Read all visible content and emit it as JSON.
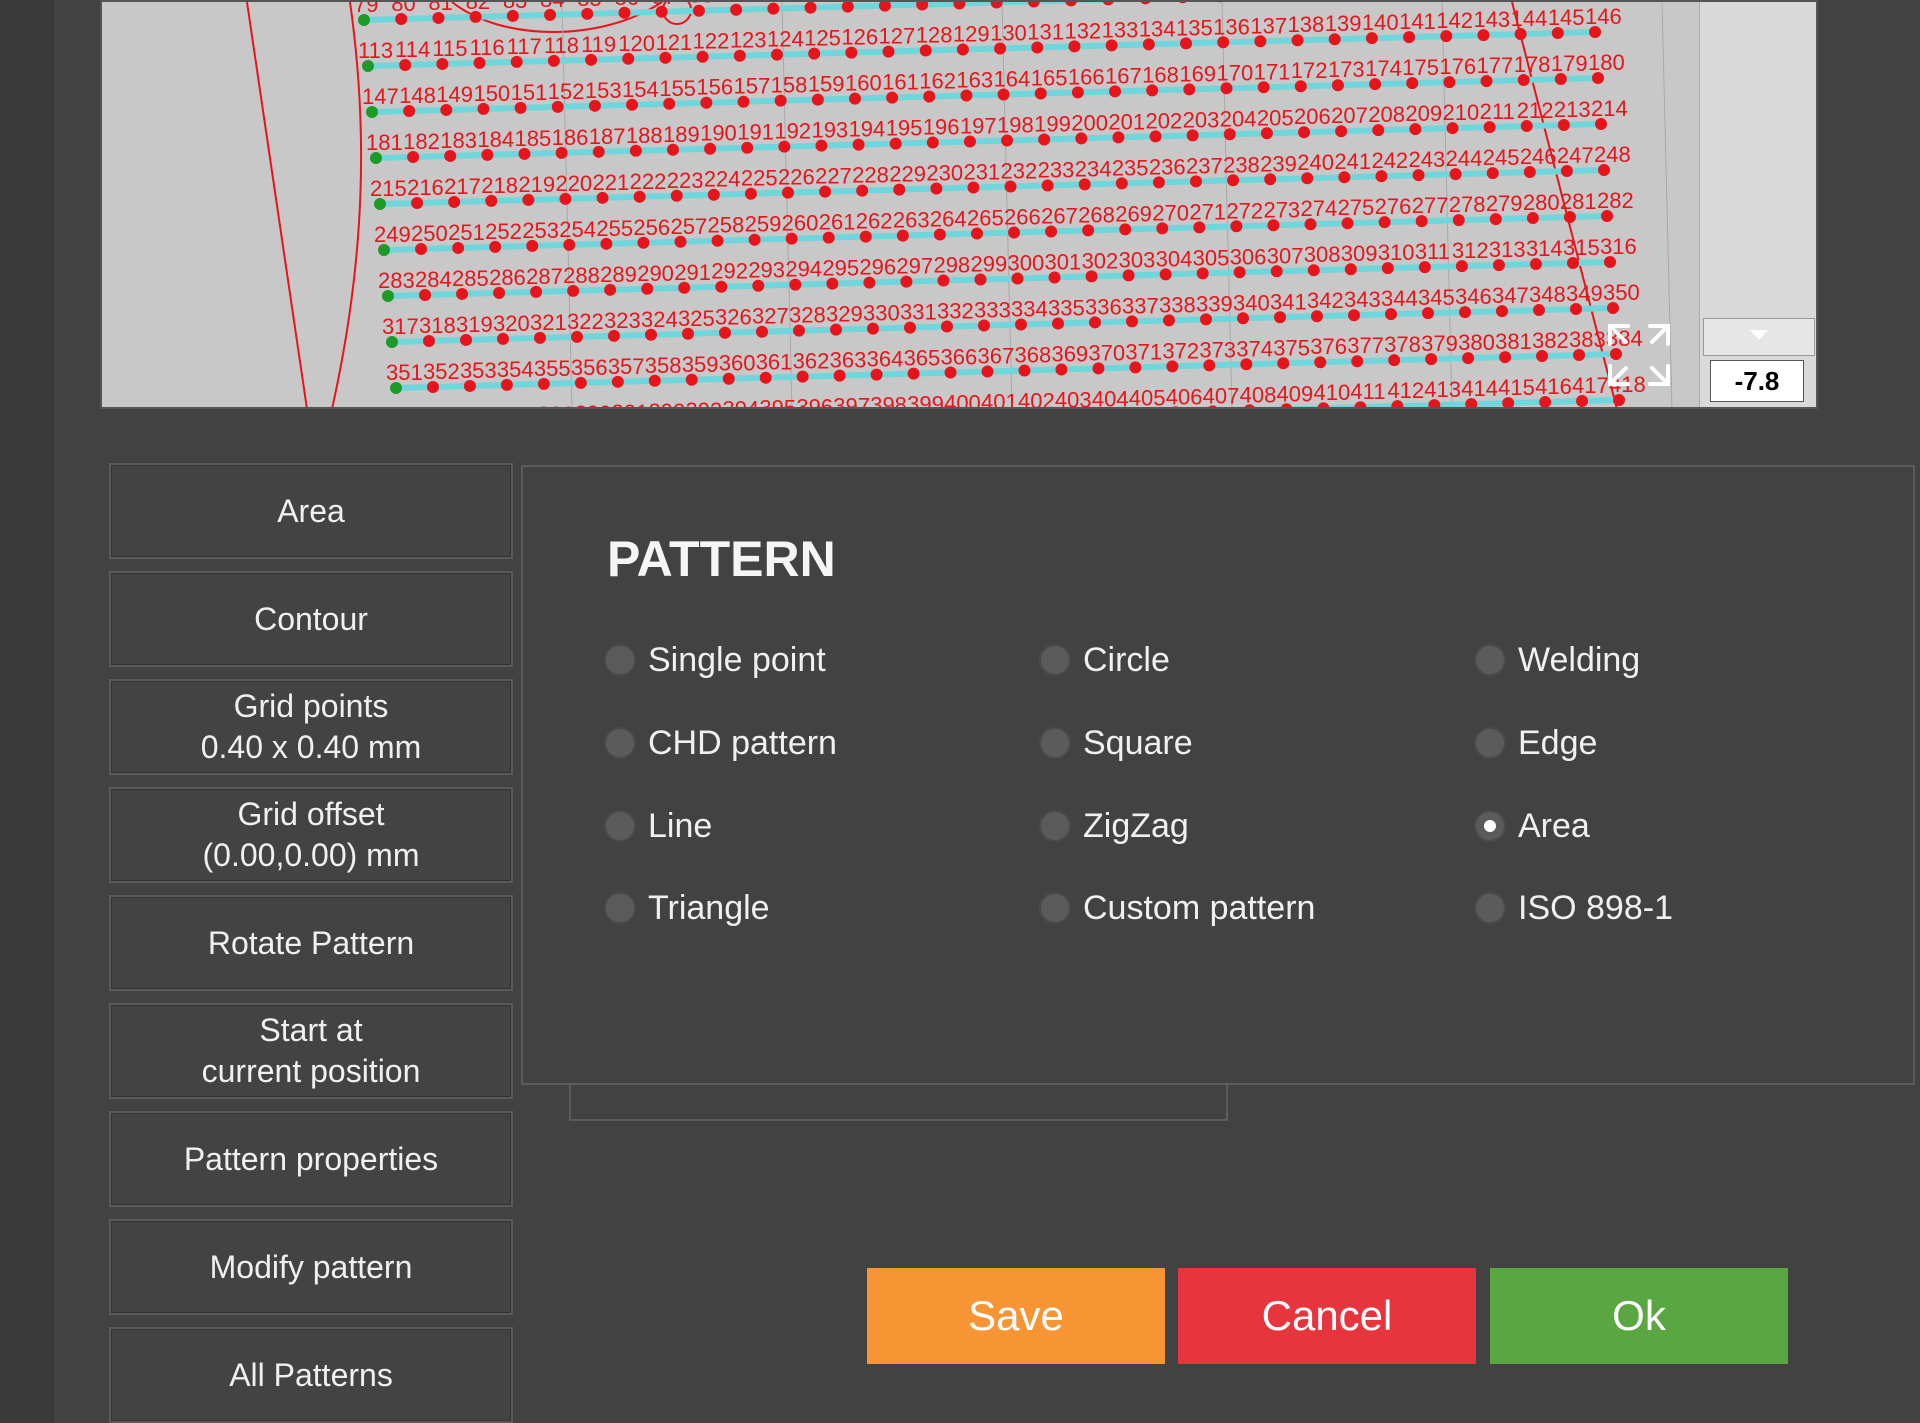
{
  "viewport": {
    "z_value": "-7.8"
  },
  "menu": [
    {
      "label": "Area"
    },
    {
      "label": "Contour"
    },
    {
      "label": "Grid points\n0.40 x 0.40 mm"
    },
    {
      "label": "Grid offset\n(0.00,0.00) mm"
    },
    {
      "label": "Rotate Pattern"
    },
    {
      "label": "Start at\ncurrent position"
    },
    {
      "label": "Pattern properties"
    },
    {
      "label": "Modify pattern"
    },
    {
      "label": "All Patterns"
    }
  ],
  "pattern": {
    "title": "PATTERN",
    "options": [
      {
        "label": "Single point",
        "checked": false
      },
      {
        "label": "Circle",
        "checked": false
      },
      {
        "label": "Welding",
        "checked": false
      },
      {
        "label": "CHD pattern",
        "checked": false
      },
      {
        "label": "Square",
        "checked": false
      },
      {
        "label": "Edge",
        "checked": false
      },
      {
        "label": "Line",
        "checked": false
      },
      {
        "label": "ZigZag",
        "checked": false
      },
      {
        "label": "Area",
        "checked": true
      },
      {
        "label": "Triangle",
        "checked": false
      },
      {
        "label": "Custom pattern",
        "checked": false
      },
      {
        "label": "ISO 898-1",
        "checked": false
      }
    ]
  },
  "actions": {
    "save": "Save",
    "cancel": "Cancel",
    "ok": "Ok"
  },
  "colors": {
    "point_red": "#e8141c",
    "point_green": "#1e9a2a",
    "path_cyan": "#6fd6dc",
    "save": "#f79433",
    "cancel": "#e8343d",
    "ok": "#5aa640"
  }
}
